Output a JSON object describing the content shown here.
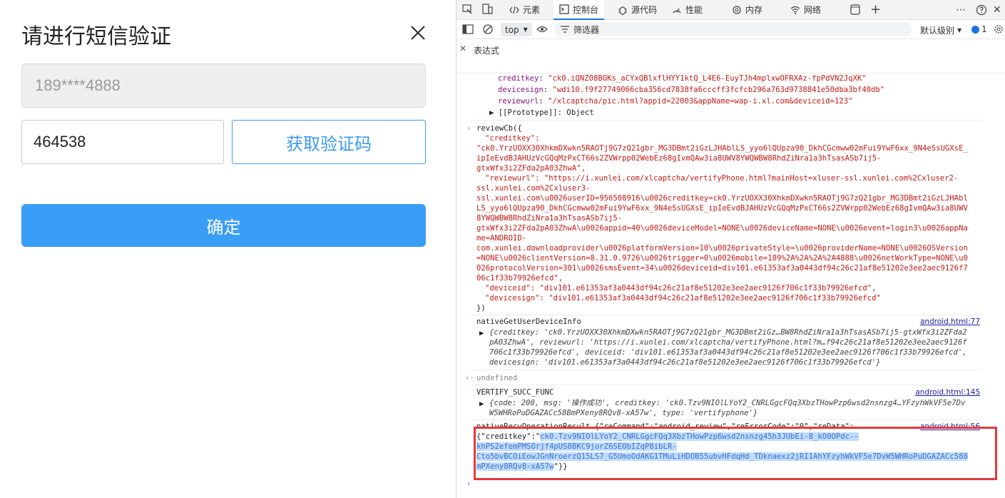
{
  "dialog": {
    "title": "请进行短信验证",
    "phone_value": "189****4888",
    "code_value": "464538",
    "get_code_label": "获取验证码",
    "confirm_label": "确定"
  },
  "devtools": {
    "tabs": [
      "元素",
      "控制台",
      "源代码",
      "性能",
      "内存",
      "网络"
    ],
    "context": "top",
    "filter_placeholder": "筛选器",
    "level_label": "默认级别",
    "issue_count": "1",
    "expression_label": "表达式",
    "colors": {
      "accent": "#1a73e8",
      "highlight_box": "#e4393c"
    }
  },
  "console": {
    "obj1": {
      "creditkey": "\"ck0.iQNZ08BOKs_aCYxQBlxflHYY1ktQ_L4E6-EuyTJh4mplxwOFRXAz-fpPdVN2JqXK\"",
      "devicesign": "\"wdi10.f9f27749066cba356cd7838fa6cccff3fcfcb296a763d9738841e50dba3bf40db\"",
      "reviewurl": "\"/xlcaptcha/pic.html?appid=22003&appName=wap-i.xl.com&deviceid=123\"",
      "prototype": "[[Prototype]]: Object"
    },
    "reviewcb": {
      "head": "reviewCb({",
      "ck_key": "\"creditkey\":",
      "ck_lines": [
        "\"ck0.YrzUOXX30XhkmDXwkn5RAOTj9G7zQ21gbr_MG3DBmt2iGzLJHAblLS_yyo6lQUpza90_DkhCGcmww02mFui9YwF6xx_9N4eSsUGXsE_",
        "ipIeEvdBJAHUzVcGQqMzPxCT66s2ZVWrpp02WebEz68gIvmQAw3ia8UWV8YWQWBW8RhdZiNra1a3hTsasASb7ij5-",
        "gtxWfx3i2ZFda2pA03ZhwA\","
      ],
      "ru_key": "\"reviewurl\": \"https://i.xunlei.com/xlcaptcha/vertifyPhone.html?mainHost=xluser-ssl.xunlei.com%2Cxluser2-",
      "ru_lines": [
        "ssl.xunlei.com%2Cxluser3-",
        "ssl.xunlei.com\\u0026userID=956508916\\u0026creditkey=ck0.YrzUOXX30XhkmDXwkn5RAOTj9G7zQ21gbr_MG3DBmt2iGzLJHAbl",
        "LS_yyo6lQUpza90_DkhCGcmww02mFui9YwF6xx_9N4eSsUGXsE_ipIeEvdBJAHUzVcGQqMzPxCT66s2ZVWrpp02WebEz68gIvmQAw3ia8UWV",
        "8YWQWBW8RhdZiNra1a3hTsasASb7ij5-",
        "gtxWfx3i2ZFda2pA03ZhwA\\u0026appid=40\\u0026deviceModel=NONE\\u0026deviceName=NONE\\u0026event=login3\\u0026appNa",
        "me=ANDROID-",
        "com.xunlei.downloadprovider\\u0026platformVersion=10\\u0026privateStyle=\\u0026providerName=NONE\\u0026OSVersion",
        "=NONE\\u0026clientVersion=8.31.0.9726\\u0026trigger=0\\u0026mobile=189%2A%2A%2A%2A4888\\u0026netWorkType=NONE\\u0",
        "026protocolVersion=301\\u0026smsEvent=34\\u0026deviceid=div101.e61353af3a0443df94c26c21af8e51202e3ee2aec9126f7",
        "06c1f33b79926efcd\","
      ],
      "deviceid": "\"deviceid\": \"div101.e61353af3a0443df94c26c21af8e51202e3ee2aec9126f706c1f33b79926efcd\",",
      "devicesign": "\"devicesign\": \"div101.e61353af3a0443df94c26c21af8e51202e3ee2aec9126f706c1f33b79926efcd\"",
      "close": "})"
    },
    "native_info": {
      "label": "nativeGetUserDeviceInfo",
      "source": "android.html:77",
      "lines": [
        "{creditkey: 'ck0.YrzUOXX30XhkmDXwkn5RAOTj9G7zQ21gbr_MG3DBmt2iGz…BW8RhdZiNra1a3hTsasASb7ij5-gtxWfx3i2ZFda2",
        "pA03ZhwA', reviewurl: 'https://i.xunlei.com/xlcaptcha/vertifyPhone.html?m…f94c26c21af8e51202e3ee2aec9126f",
        "706c1f33b79926efcd', deviceid: 'div101.e61353af3a0443df94c26c21af8e51202e3ee2aec9126f706c1f33b79926efcd',",
        "devicesign: 'div101.e61353af3a0443df94c26c21af8e51202e3ee2aec9126f706c1f33b79926efcd'}"
      ]
    },
    "undefined_label": "undefined",
    "verify": {
      "label": "VERTIFY_SUCC_FUNC",
      "source": "android.html:145",
      "lines": [
        "{code: 200, msg: '操作成功', creditkey: 'ck0.Tzv9NIOlLYoY2_CNRLGgcFQq3XbzTHowPzp6wsd2nsnzg4…YFzyhWkVF5e7Dv",
        "W5WHRoPuDGAZACc58BmPXeny8RQv8-xA57w', type: 'vertifyphone'}"
      ]
    },
    "recv": {
      "label": "nativeRecvOperationResult {\"reCommand\":\"android_review\",\"reErrorCode\":\"0\",\"reData\":",
      "source": "android.html:56",
      "prefix": "{\"creditkey\":\"",
      "hl1": "ck0.Tzv9NIOlLYoY2_CNRLGgcFQq3XbzTHowPzp6wsd2nsnzg45h3JUbEi-8_kO0OPdc--",
      "hl2": "khPS2efemPMSOrjf4pUS8BKC9jorZ6SEObIZqP8ibLR-",
      "hl3": "Cto5bvBCOiEowJGnNroerzQ15LS7_G5UmoOdAKG1TMuLiHDOB55ubvHFdqHd_TDknaexz2jRI1AhYFzyhWkVF5e7DvW5WHRoPuDGAZACc588",
      "hl4": "mPXeny8RQv8-xA57w",
      "suffix": "\"}}"
    }
  }
}
